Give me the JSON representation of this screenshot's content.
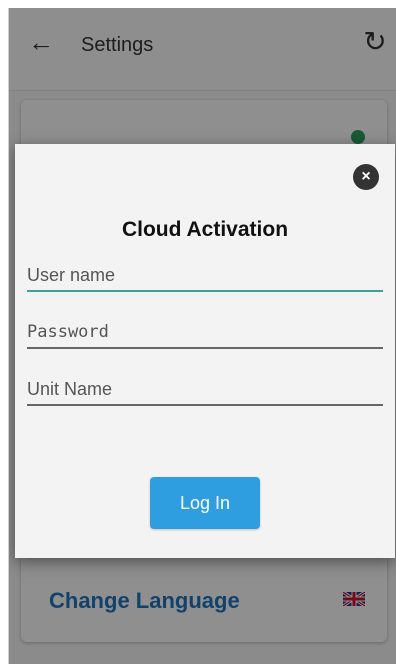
{
  "header": {
    "title": "Settings",
    "back_icon": "arrow-left-icon",
    "refresh_icon": "refresh-icon"
  },
  "cards": {
    "change_language_label": "Change Language",
    "flag_icon": "uk-flag-icon"
  },
  "dialog": {
    "title": "Cloud Activation",
    "username_placeholder": "User name",
    "password_placeholder": "Password",
    "unit_name_placeholder": "Unit Name",
    "login_label": "Log In",
    "close_icon": "close-icon"
  },
  "colors": {
    "accent_blue": "#2f9ee1",
    "link_blue": "#1e73b8",
    "active_underline": "#3aa39a"
  }
}
